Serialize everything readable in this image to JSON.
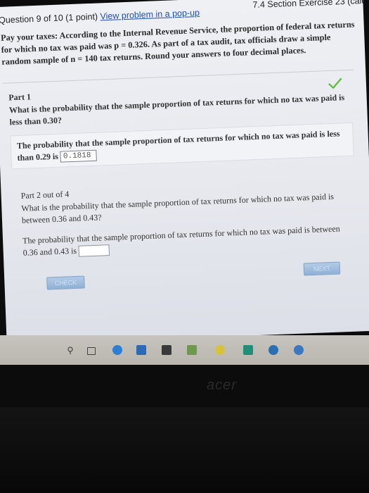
{
  "header": {
    "question_label": "Question 9 of 10 (1 point)",
    "popup_link": "View problem in a pop-up",
    "section": "7.4 Section Exercise 23 (calc"
  },
  "problem": {
    "text": "Pay your taxes: According to the Internal Revenue Service, the proportion of federal tax returns for which no tax was paid was p = 0.326. As part of a tax audit, tax officials draw a simple random sample of n = 140 tax returns. Round your answers to four decimal places."
  },
  "part1": {
    "title": "Part 1",
    "question": "What is the probability that the sample proportion of tax returns for which no tax was paid is less than 0.30?",
    "answer_prefix": "The probability that the sample proportion of tax returns for which no tax was paid is less than 0.29 is",
    "answer_value": "0.1818",
    "status": "correct"
  },
  "part2": {
    "title": "Part 2 out of 4",
    "question": "What is the probability that the sample proportion of tax returns for which no tax was paid is between 0.36 and 0.43?",
    "answer_prefix": "The probability that the sample proportion of tax returns for which no tax was paid is between 0.36 and 0.43 is",
    "answer_value": ""
  },
  "buttons": {
    "check": "CHECK",
    "next": "NEXT"
  },
  "taskbar": {
    "icons": [
      "search-icon",
      "task-view-icon",
      "edge-icon",
      "store-icon",
      "calculator-icon",
      "minecraft-icon",
      "chrome-icon",
      "publisher-icon",
      "app-icon",
      "app2-icon"
    ]
  },
  "device": {
    "brand": "acer"
  },
  "colors": {
    "link": "#1f4fb5",
    "check": "#5fbf3f",
    "button": "#9fbde0"
  }
}
